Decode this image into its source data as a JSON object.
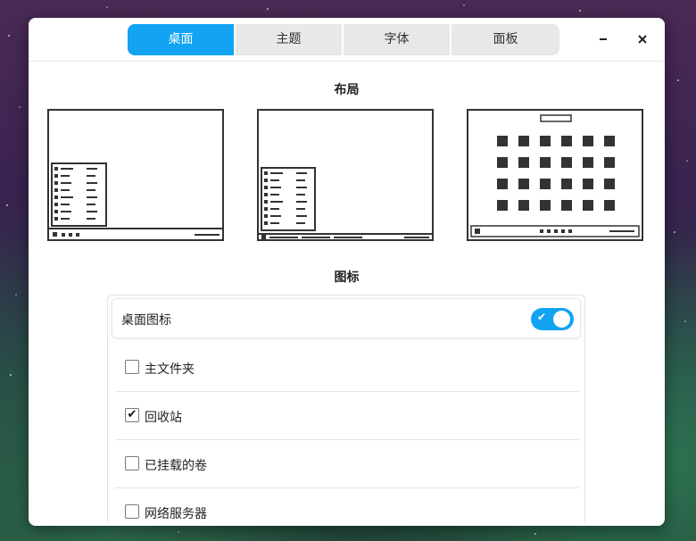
{
  "tabs": [
    {
      "label": "桌面",
      "active": true
    },
    {
      "label": "主题",
      "active": false
    },
    {
      "label": "字体",
      "active": false
    },
    {
      "label": "面板",
      "active": false
    }
  ],
  "window_buttons": {
    "minimize": "−",
    "close": "✕"
  },
  "layout": {
    "title": "布局",
    "options": [
      "traditional-menu",
      "bottom-panel-menu",
      "fullscreen-grid"
    ]
  },
  "icons": {
    "title": "图标",
    "desktop_icons_label": "桌面图标",
    "desktop_icons_enabled": true,
    "items": [
      {
        "label": "主文件夹",
        "checked": false
      },
      {
        "label": "回收站",
        "checked": true
      },
      {
        "label": "已挂载的卷",
        "checked": false
      },
      {
        "label": "网络服务器",
        "checked": false
      }
    ]
  },
  "colors": {
    "accent": "#12a4f2"
  }
}
